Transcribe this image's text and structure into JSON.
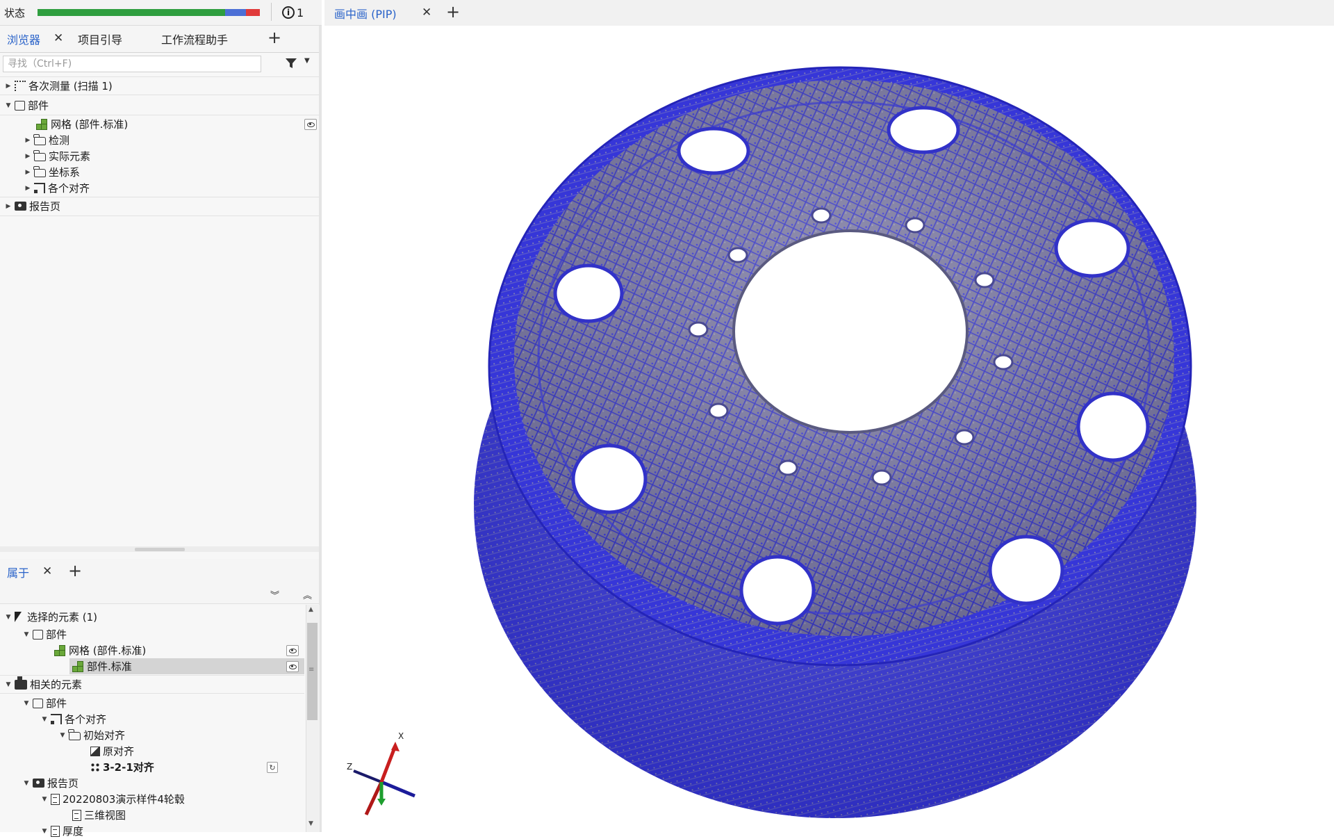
{
  "status": {
    "label": "状态",
    "info_count": "1"
  },
  "browser_tabs": [
    {
      "label": "浏览器",
      "active": true
    },
    {
      "label": "项目引导",
      "active": false
    },
    {
      "label": "工作流程助手",
      "active": false
    }
  ],
  "search": {
    "placeholder": "寻找（Ctrl+F)"
  },
  "explorer_tree": {
    "measurements": "各次测量 (扫描 1)",
    "parts": "部件",
    "mesh": "网格 (部件.标准)",
    "inspection": "检测",
    "actual_elements": "实际元素",
    "coord_systems": "坐标系",
    "alignments": "各个对齐",
    "report_pages": "报告页"
  },
  "props_tab": {
    "label": "属于"
  },
  "props_tree": {
    "selected_elements": "选择的元素 (1)",
    "parts": "部件",
    "mesh": "网格 (部件.标准)",
    "part_standard": "部件.标准",
    "related_elements": "相关的元素",
    "related_parts": "部件",
    "alignments": "各个对齐",
    "initial_alignment": "初始对齐",
    "original_alignment": "原对齐",
    "alignment_321": "3-2-1对齐",
    "report_pages": "报告页",
    "report_doc": "20220803演示样件4轮毂",
    "view_3d": "三维视图",
    "thickness": "厚度"
  },
  "viewport": {
    "tab_label": "画中画 (PIP)",
    "axis_x": "X",
    "axis_z": "Z",
    "mesh_color": "#2b2bd6",
    "surface_color": "#8c8aa6"
  },
  "icons": [
    "info-icon",
    "close-icon",
    "plus-icon",
    "filter-icon",
    "eye-icon",
    "mesh-icon",
    "folder-icon",
    "camera-icon",
    "align-icon",
    "cursor-icon",
    "refresh-icon"
  ],
  "colors": {
    "accent": "#2a63c9",
    "status_green": "#2f9e3f",
    "status_blue": "#4c6fd6",
    "status_red": "#e03a3a"
  }
}
